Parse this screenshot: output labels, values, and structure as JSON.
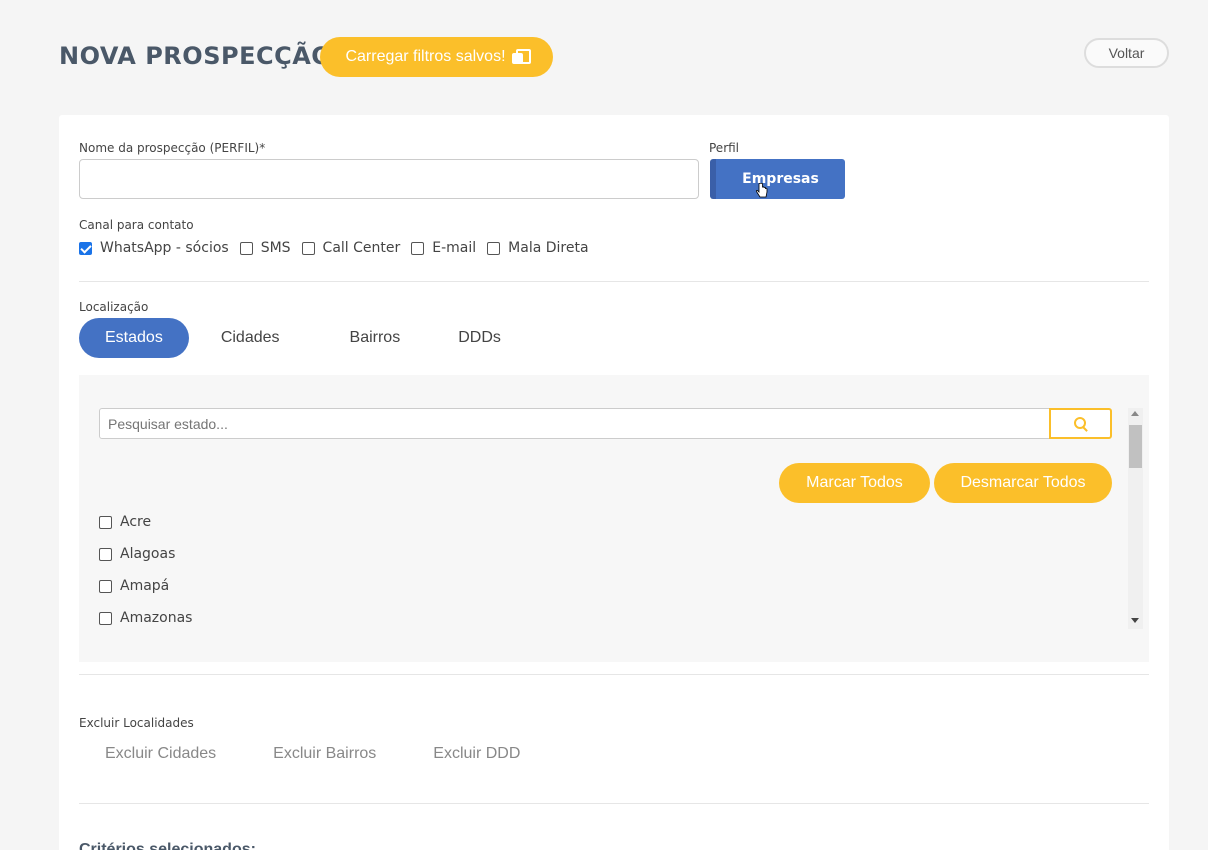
{
  "header": {
    "title": "NOVA PROSPECÇÃO",
    "load_filters_label": "Carregar filtros salvos!",
    "load_filters_icon": "copy-icon",
    "back_label": "Voltar"
  },
  "form": {
    "name_label": "Nome da prospecção (PERFIL)*",
    "name_value": "",
    "profile_label": "Perfil",
    "profile_button": "Empresas",
    "channel_label": "Canal para contato",
    "channels": [
      {
        "label": "WhatsApp - sócios",
        "checked": true
      },
      {
        "label": "SMS",
        "checked": false
      },
      {
        "label": "Call Center",
        "checked": false
      },
      {
        "label": "E-mail",
        "checked": false
      },
      {
        "label": "Mala Direta",
        "checked": false
      }
    ]
  },
  "location": {
    "label": "Localização",
    "tabs": [
      "Estados",
      "Cidades",
      "Bairros",
      "DDDs"
    ],
    "active_tab": "Estados",
    "search_placeholder": "Pesquisar estado...",
    "mark_all": "Marcar Todos",
    "unmark_all": "Desmarcar Todos",
    "states": [
      "Acre",
      "Alagoas",
      "Amapá",
      "Amazonas"
    ]
  },
  "exclude": {
    "label": "Excluir Localidades",
    "tabs": [
      "Excluir Cidades",
      "Excluir Bairros",
      "Excluir DDD"
    ]
  },
  "criteria": {
    "title": "Critérios selecionados:"
  },
  "colors": {
    "accent_yellow": "#fbbf2a",
    "accent_blue": "#4472c4",
    "title_gray": "#4a5868"
  }
}
